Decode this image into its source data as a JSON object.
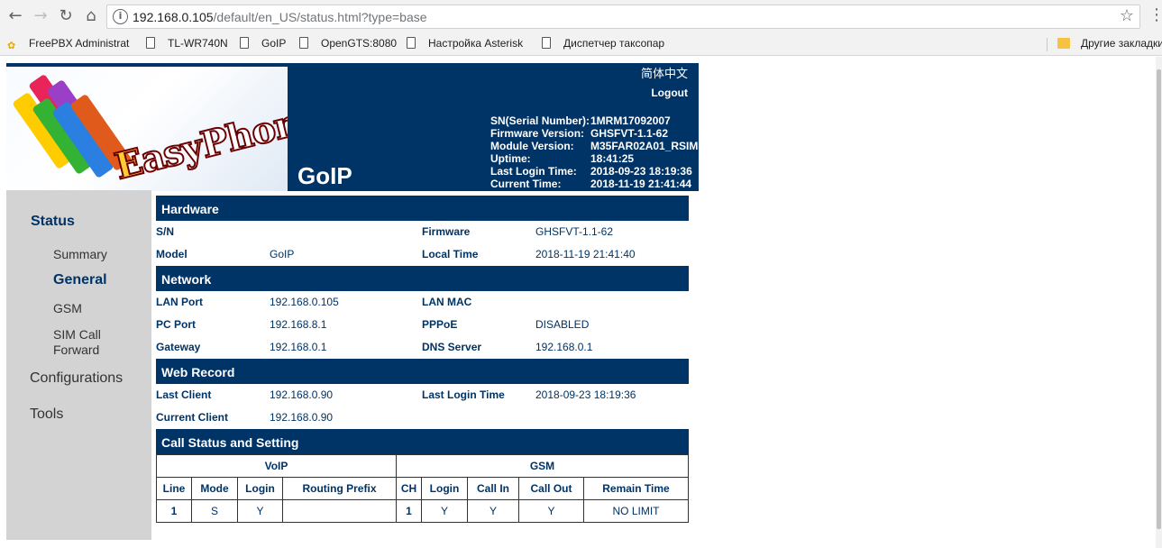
{
  "browser": {
    "url_host": "192.168.0.105",
    "url_path": "/default/en_US/status.html?type=base",
    "bookmarks": [
      {
        "label": "FreePBX Administrat"
      },
      {
        "label": "TL-WR740N"
      },
      {
        "label": "GoIP"
      },
      {
        "label": "OpenGTS:8080"
      },
      {
        "label": "Настройка Asterisk"
      },
      {
        "label": "Диспетчер таксопар"
      }
    ],
    "other_bookmarks": "Другие закладки"
  },
  "header": {
    "logo_text_e": "E",
    "logo_text_rest": "asyPhone",
    "product": "GoIP",
    "language_link": "简体中文",
    "logout": "Logout",
    "info": [
      {
        "label": "SN(Serial Number):",
        "value": "1MRM17092007"
      },
      {
        "label": "Firmware Version:",
        "value": "GHSFVT-1.1-62"
      },
      {
        "label": "Module Version:",
        "value": "M35FAR02A01_RSIM"
      },
      {
        "label": "Uptime:",
        "value": "18:41:25"
      },
      {
        "label": "Last Login Time:",
        "value": "2018-09-23 18:19:36"
      },
      {
        "label": "Current Time:",
        "value": "2018-11-19 21:41:44"
      }
    ]
  },
  "menu": {
    "status": "Status",
    "summary": "Summary",
    "general": "General",
    "gsm": "GSM",
    "sim_call_forward_1": "SIM Call",
    "sim_call_forward_2": "Forward",
    "configurations": "Configurations",
    "tools": "Tools"
  },
  "hardware": {
    "title": "Hardware",
    "sn_label": "S/N",
    "sn_value": "",
    "firmware_label": "Firmware",
    "firmware_value": "GHSFVT-1.1-62",
    "model_label": "Model",
    "model_value": "GoIP",
    "localtime_label": "Local Time",
    "localtime_value": "2018-11-19 21:41:40"
  },
  "network": {
    "title": "Network",
    "lanport_label": "LAN Port",
    "lanport_value": "192.168.0.105",
    "lanmac_label": "LAN MAC",
    "lanmac_value": "",
    "pcport_label": "PC Port",
    "pcport_value": "192.168.8.1",
    "pppoe_label": "PPPoE",
    "pppoe_value": "DISABLED",
    "gateway_label": "Gateway",
    "gateway_value": "192.168.0.1",
    "dns_label": "DNS Server",
    "dns_value": "192.168.0.1"
  },
  "webrecord": {
    "title": "Web Record",
    "lastclient_label": "Last Client",
    "lastclient_value": "192.168.0.90",
    "lastlogin_label": "Last Login Time",
    "lastlogin_value": "2018-09-23 18:19:36",
    "currentclient_label": "Current Client",
    "currentclient_value": "192.168.0.90"
  },
  "callstatus": {
    "title": "Call Status and Setting",
    "voip_header": "VoIP",
    "gsm_header": "GSM",
    "columns": [
      "Line",
      "Mode",
      "Login",
      "Routing Prefix",
      "CH",
      "Login",
      "Call In",
      "Call Out",
      "Remain Time"
    ],
    "row": [
      "1",
      "S",
      "Y",
      "",
      "1",
      "Y",
      "Y",
      "Y",
      "NO LIMIT"
    ]
  }
}
